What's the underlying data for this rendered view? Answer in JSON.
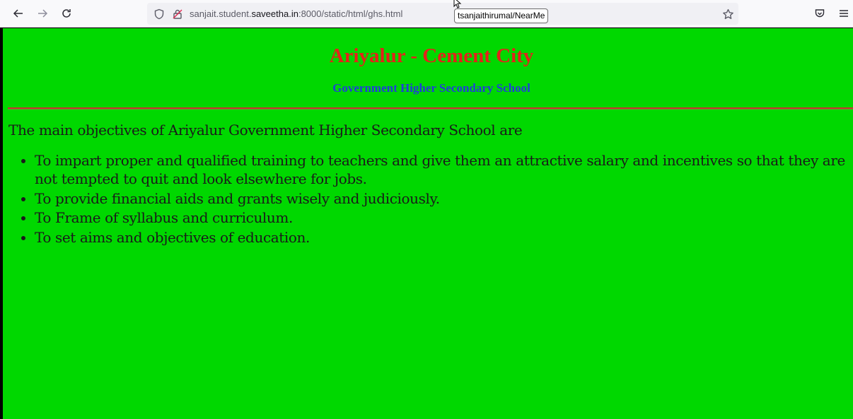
{
  "browser": {
    "url_prefix": "sanjait.student.",
    "url_domain": "saveetha.in",
    "url_suffix": ":8000/static/html/ghs.html",
    "tooltip": "tsanjaithirumal/NearMe"
  },
  "page": {
    "background": "#00d800",
    "title": "Ariyalur - Cement City",
    "subtitle": "Government Higher Secondary School",
    "intro": "The main objectives of Ariyalur Government Higher Secondary School are",
    "objectives": [
      "To impart proper and qualified training to teachers and give them an attractive salary and incentives so that they are not tempted to quit and look elsewhere for jobs.",
      "To provide financial aids and grants wisely and judiciously.",
      "To Frame of syllabus and curriculum.",
      "To set aims and objectives of education."
    ]
  },
  "colors": {
    "title": "#e4221a",
    "subtitle": "#1f3fd9"
  }
}
